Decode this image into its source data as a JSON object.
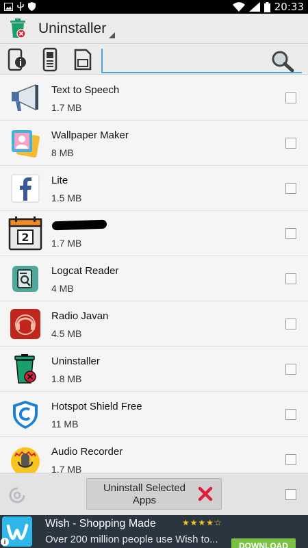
{
  "status_bar": {
    "time": "20:33",
    "icons": [
      "image-icon",
      "usb-icon",
      "shield-icon",
      "wifi-icon",
      "signal-icon",
      "battery-icon"
    ]
  },
  "action_bar": {
    "title": "Uninstaller",
    "icon": "trash-icon"
  },
  "toolbar": {
    "tabs": [
      "phone-info-icon",
      "phone-apps-icon",
      "sd-card-icon"
    ],
    "search": {
      "value": "",
      "placeholder": ""
    }
  },
  "apps": [
    {
      "name": "Text to Speech",
      "size": "1.7 MB",
      "icon": "megaphone-icon",
      "checked": false
    },
    {
      "name": "Wallpaper Maker",
      "size": "8 MB",
      "icon": "wallpaper-icon",
      "checked": false
    },
    {
      "name": "Lite",
      "size": "1.5 MB",
      "icon": "facebook-icon",
      "checked": false
    },
    {
      "name": "",
      "size": "1.7 MB",
      "icon": "calendar-icon",
      "checked": false,
      "redacted": true
    },
    {
      "name": "Logcat Reader",
      "size": "4 MB",
      "icon": "logcat-icon",
      "checked": false
    },
    {
      "name": "Radio Javan",
      "size": "4.5 MB",
      "icon": "radio-icon",
      "checked": false
    },
    {
      "name": "Uninstaller",
      "size": "1.8 MB",
      "icon": "trash-icon",
      "checked": false
    },
    {
      "name": "Hotspot Shield Free",
      "size": "11 MB",
      "icon": "shield-icon",
      "checked": false
    },
    {
      "name": "Audio Recorder",
      "size": "1.7 MB",
      "icon": "microphone-icon",
      "checked": false
    }
  ],
  "bottom_bar": {
    "uninstall_label": "Uninstall Selected Apps"
  },
  "ad": {
    "title": "Wish - Shopping Made",
    "stars": "★★★★☆",
    "description": "Over 200 million people use Wish to...",
    "cta": "DOWNLOAD",
    "info": "i",
    "colors": {
      "background": "#2a3540",
      "cta": "#7ac143",
      "logo": "#2fb7ec"
    }
  },
  "colors": {
    "accent": "#4aa3d6",
    "trash": "#1a9e6b",
    "uninstall_x": "#e0203a"
  }
}
